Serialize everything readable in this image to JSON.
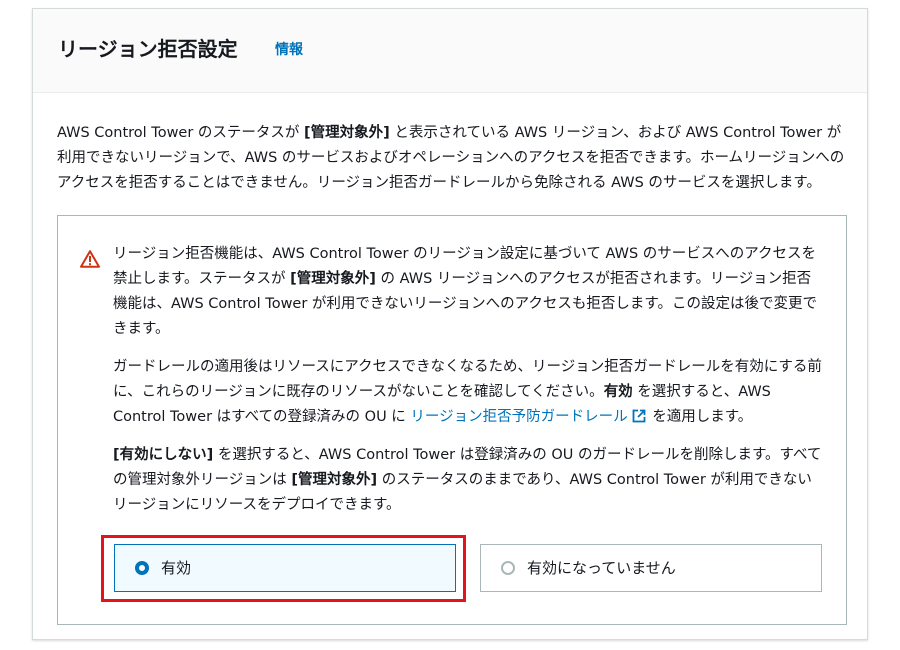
{
  "header": {
    "title": "リージョン拒否設定",
    "info_link": "情報"
  },
  "intro": {
    "part1": "AWS Control Tower のステータスが ",
    "status_bold": "[管理対象外]",
    "part2": " と表示されている AWS リージョン、および AWS Control Tower が利用できないリージョンで、AWS のサービスおよびオペレーションへのアクセスを拒否できます。ホームリージョンへのアクセスを拒否することはできません。リージョン拒否ガードレールから免除される AWS のサービスを選択します。"
  },
  "warning": {
    "icon": "warning-triangle-icon",
    "p1_a": "リージョン拒否機能は、AWS Control Tower のリージョン設定に基づいて AWS のサービスへのアクセスを禁止します。ステータスが ",
    "p1_bold": "[管理対象外]",
    "p1_b": " の AWS リージョンへのアクセスが拒否されます。リージョン拒否機能は、AWS Control Tower が利用できないリージョンへのアクセスも拒否します。この設定は後で変更できます。",
    "p2_a": "ガードレールの適用後はリソースにアクセスできなくなるため、リージョン拒否ガードレールを有効にする前に、これらのリージョンに既存のリソースがないことを確認してください。",
    "p2_bold": "有効",
    "p2_b": " を選択すると、AWS Control Tower はすべての登録済みの OU に ",
    "p2_link": "リージョン拒否予防ガードレール",
    "p2_c": " を適用します。",
    "p3_bold1": "[有効にしない]",
    "p3_a": " を選択すると、AWS Control Tower は登録済みの OU のガードレールを削除します。すべての管理対象外リージョンは ",
    "p3_bold2": "[管理対象外]",
    "p3_b": " のステータスのままであり、AWS Control Tower が利用できないリージョンにリソースをデプロイできます。"
  },
  "options": [
    {
      "label": "有効",
      "selected": true
    },
    {
      "label": "有効になっていません",
      "selected": false
    }
  ],
  "colors": {
    "link": "#0073bb",
    "warning": "#d13212",
    "highlight": "#e3151a",
    "selected_bg": "#f1faff"
  }
}
